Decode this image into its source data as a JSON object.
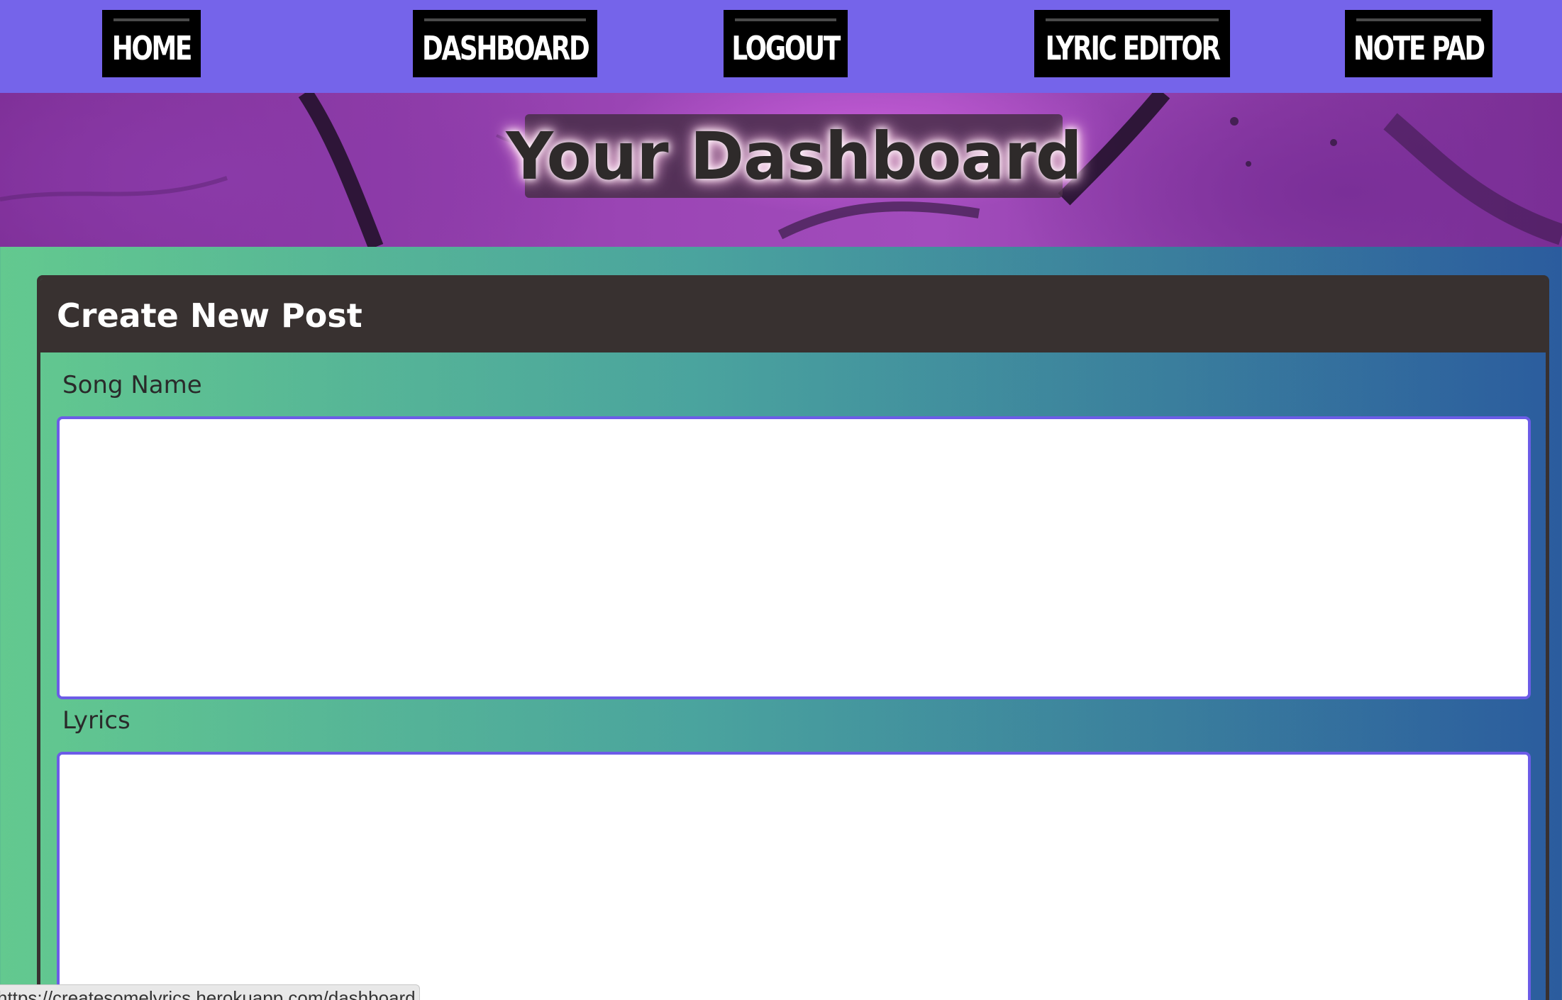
{
  "nav": {
    "home": "HOME",
    "dashboard": "DASHBOARD",
    "logout": "LOGOUT",
    "lyric_editor": "LYRIC EDITOR",
    "note_pad": "NOTE PAD"
  },
  "hero": {
    "title": "Your Dashboard"
  },
  "post_form": {
    "title": "Create New Post",
    "song_name_label": "Song Name",
    "song_name_value": "",
    "lyrics_label": "Lyrics",
    "lyrics_value": ""
  },
  "status_bar": {
    "url": "https://createsomelyrics.herokuapp.com/dashboard"
  },
  "colors": {
    "nav_bg": "#7564ea",
    "nav_button_bg": "#000000",
    "card_header_bg": "#383130",
    "input_border": "#6c5ce7",
    "page_gradient_start": "#63c98f",
    "page_gradient_end": "#2b5c9e"
  }
}
